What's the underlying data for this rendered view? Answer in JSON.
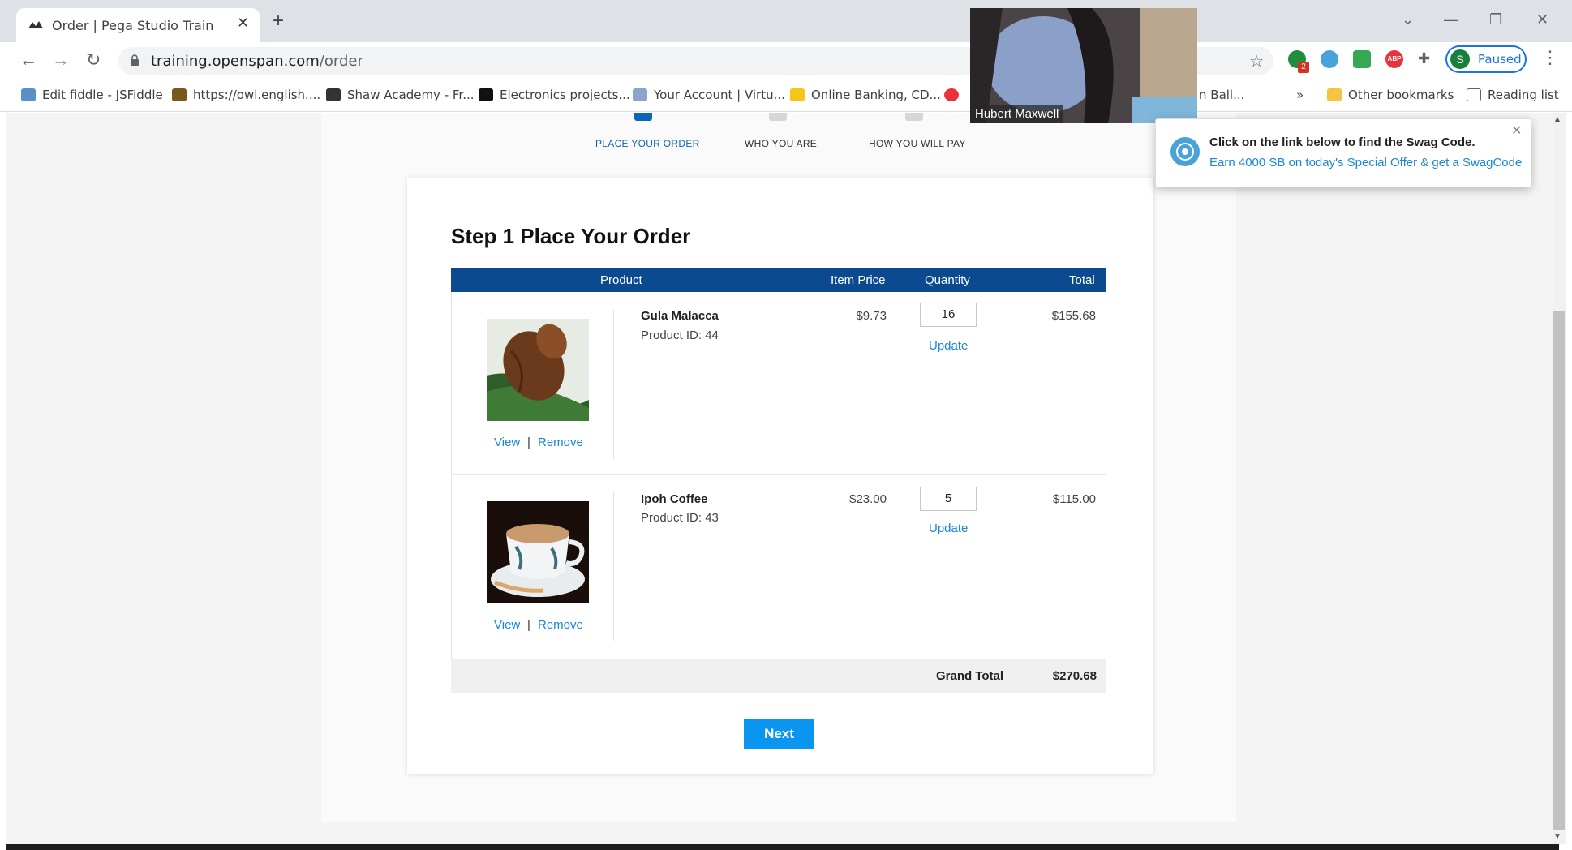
{
  "browser": {
    "tab_title": "Order | Pega Studio Training Web",
    "tab_close": "✕",
    "new_tab": "+",
    "url_host": "training.openspan.com",
    "url_path": "/order",
    "profile_initial": "S",
    "profile_label": "Paused",
    "extension_badge": "2",
    "extension_abp": "ABP",
    "more_bookmarks": "»",
    "reading_list": "Reading list",
    "other_bookmarks": "Other bookmarks",
    "bookmarks": [
      {
        "label": "Edit fiddle - JSFiddle",
        "color": "#5b8fc7"
      },
      {
        "label": "https://owl.english....",
        "color": "#7a5a1c"
      },
      {
        "label": "Shaw Academy - Fr...",
        "color": "#333333"
      },
      {
        "label": "Electronics projects...",
        "color": "#111111"
      },
      {
        "label": "Your Account | Virtu...",
        "color": "#8aa6c8"
      },
      {
        "label": "Online Banking, CD...",
        "color": "#f5c518"
      },
      {
        "label": "n Ball...",
        "color": "#ffffff"
      }
    ]
  },
  "steps": [
    {
      "label": "PLACE YOUR ORDER",
      "active": true
    },
    {
      "label": "WHO YOU ARE",
      "active": false
    },
    {
      "label": "HOW YOU WILL PAY",
      "active": false
    }
  ],
  "order": {
    "title": "Step 1 Place Your Order",
    "columns": {
      "product": "Product",
      "price": "Item Price",
      "quantity": "Quantity",
      "total": "Total"
    },
    "items": [
      {
        "name": "Gula Malacca",
        "product_id": "Product ID: 44",
        "price": "$9.73",
        "quantity": "16",
        "update": "Update",
        "total": "$155.68",
        "view": "View",
        "remove": "Remove",
        "sep": "|"
      },
      {
        "name": "Ipoh Coffee",
        "product_id": "Product ID: 43",
        "price": "$23.00",
        "quantity": "5",
        "update": "Update",
        "total": "$115.00",
        "view": "View",
        "remove": "Remove",
        "sep": "|"
      }
    ],
    "grand_total_label": "Grand Total",
    "grand_total_value": "$270.68",
    "next_label": "Next"
  },
  "video": {
    "participant": "Hubert Maxwell"
  },
  "notification": {
    "title": "Click on the link below to find the Swag Code.",
    "link": "Earn 4000 SB on today's Special Offer & get a SwagCode",
    "close": "✕"
  },
  "colors": {
    "header_blue": "#0b4a8f",
    "link_blue": "#1787d6",
    "button_blue": "#0a95f0"
  }
}
